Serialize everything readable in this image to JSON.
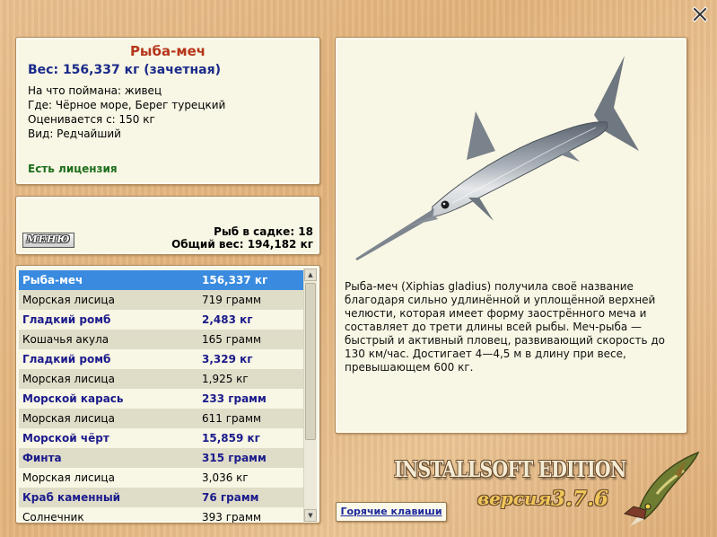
{
  "info": {
    "name": "Рыба-меч",
    "weight": "Вес: 156,337 кг (зачетная)",
    "bait": "На что поймана: живец",
    "location": "Где: Чёрное море, Берег турецкий",
    "valued_from": "Оценивается с: 150 кг",
    "kind": "Вид: Редчайший",
    "license": "Есть лицензия"
  },
  "cage": {
    "menu_label": "МЕНЮ",
    "count": "Рыб в садке: 18",
    "total_weight": "Общий вес: 194,182 кг"
  },
  "catch_list": [
    {
      "name": "Рыба-меч",
      "weight": "156,337 кг",
      "bold": true,
      "selected": true
    },
    {
      "name": "Морская лисица",
      "weight": "719 грамм",
      "bold": false
    },
    {
      "name": "Гладкий ромб",
      "weight": "2,483 кг",
      "bold": true
    },
    {
      "name": "Кошачья акула",
      "weight": "165 грамм",
      "bold": false
    },
    {
      "name": "Гладкий ромб",
      "weight": "3,329 кг",
      "bold": true
    },
    {
      "name": "Морская лисица",
      "weight": "1,925 кг",
      "bold": false
    },
    {
      "name": "Морской карась",
      "weight": "233 грамм",
      "bold": true
    },
    {
      "name": "Морская лисица",
      "weight": "611 грамм",
      "bold": false
    },
    {
      "name": "Морской чёрт",
      "weight": "15,859 кг",
      "bold": true
    },
    {
      "name": "Финта",
      "weight": "315 грамм",
      "bold": true
    },
    {
      "name": "Морская лисица",
      "weight": "3,036 кг",
      "bold": false
    },
    {
      "name": "Краб каменный",
      "weight": "76 грамм",
      "bold": true
    },
    {
      "name": "Солнечник",
      "weight": "393 грамм",
      "bold": false
    }
  ],
  "description": "Рыба-меч (Xiphias gladius) получила своё название благодаря сильно удлинённой и уплощённой верхней челюсти, которая имеет форму заострённого меча и составляет до трети длины всей рыбы. Меч-рыба — быстрый и активный пловец, развивающий скорость до 130 км/час. Достигает 4—4,5 м в длину при весе, превышающем 600 кг.",
  "hotkeys_label": "Горячие клавиши",
  "branding": {
    "edition": "INSTALLSOFT EDITION",
    "version_label": "версия",
    "version_number": "3.7.6"
  },
  "icons": {
    "close": "close-icon",
    "fish_photo": "swordfish-image",
    "logo": "pike-logo"
  },
  "colors": {
    "background": "#e6b882",
    "panel": "#f8f6e4",
    "title_red": "#b6361a",
    "bold_blue": "#1b1b8c",
    "license_green": "#1d6e1d",
    "selection": "#3a8be0"
  }
}
